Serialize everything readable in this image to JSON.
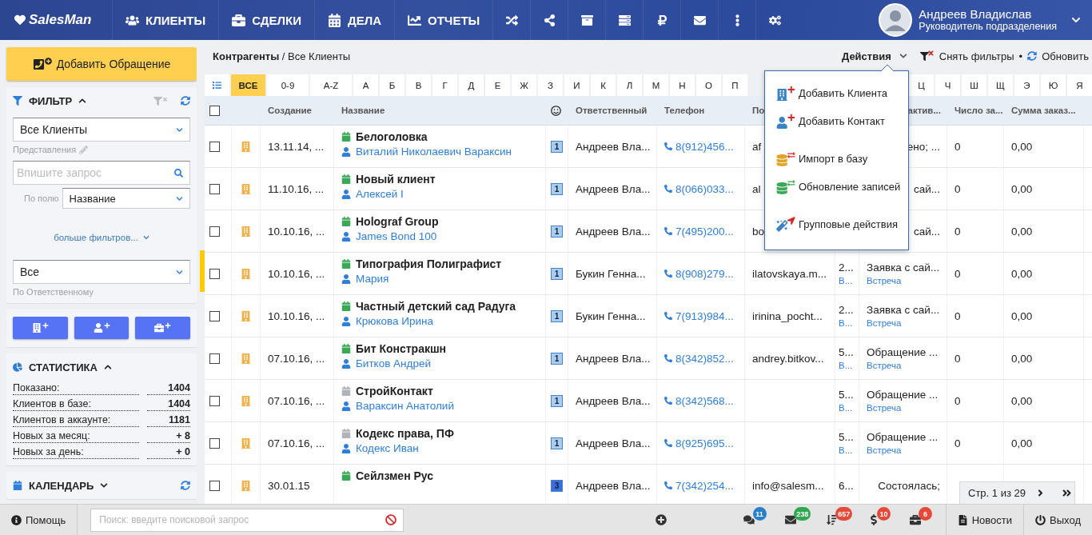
{
  "topbar": {
    "logo": "SalesMan",
    "nav": [
      {
        "label": "КЛИЕНТЫ"
      },
      {
        "label": "СДЕЛКИ"
      },
      {
        "label": "ДЕЛА"
      },
      {
        "label": "ОТЧЕТЫ"
      }
    ],
    "user": {
      "name": "Андреев Владислав",
      "role": "Руководитель подразделения"
    }
  },
  "sidebar": {
    "add_request_button": "Добавить Обращение",
    "filter": {
      "title": "ФИЛЬТР",
      "expanded": true,
      "view_select": "Все Клиенты",
      "view_label": "Представления",
      "search_placeholder": "Впишите запрос",
      "field_label": "По полю",
      "field_select": "Название",
      "more_filters": "больше фильтров...",
      "owner_select": "Все",
      "owner_label": "По Ответственному"
    },
    "statistics": {
      "title": "СТАТИСТИКА",
      "expanded": true,
      "rows": [
        {
          "label": "Показано:",
          "value": "1404"
        },
        {
          "label": "Клиентов в базе:",
          "value": "1404"
        },
        {
          "label": "Клиентов в аккаунте:",
          "value": "1181"
        },
        {
          "label": "Новых за месяц:",
          "value": "+ 8"
        },
        {
          "label": "Новых за день:",
          "value": "+ 0"
        }
      ]
    },
    "calendar": {
      "title": "КАЛЕНДАРЬ",
      "expanded": false
    }
  },
  "main": {
    "breadcrumb": "**Контрагенты** / Все Клиенты",
    "actions": {
      "label": "Действия",
      "expanded": true,
      "groups": [
        [
          {
            "label": "Добавить Клиента"
          },
          {
            "label": "Добавить Контакт"
          }
        ],
        [
          {
            "label": "Импорт в базу"
          },
          {
            "label": "Обновление записей"
          }
        ],
        [
          {
            "label": "Групповые действия"
          }
        ]
      ]
    },
    "clear_filters": "Снять фильтры",
    "separator": "•",
    "refresh": "Обновить",
    "letters_left": [
      {
        "label": "ВСЕ",
        "selected": true
      },
      {
        "label": "0-9",
        "selected": false
      },
      {
        "label": "A-Z",
        "selected": false
      },
      {
        "label": "А",
        "selected": false
      },
      {
        "label": "Б",
        "selected": false
      },
      {
        "label": "В",
        "selected": false
      },
      {
        "label": "Г",
        "selected": false
      },
      {
        "label": "Д",
        "selected": false
      },
      {
        "label": "Е",
        "selected": false
      },
      {
        "label": "Ж",
        "selected": false
      },
      {
        "label": "З",
        "selected": false
      },
      {
        "label": "И",
        "selected": false
      },
      {
        "label": "К",
        "selected": false
      },
      {
        "label": "Л",
        "selected": false
      },
      {
        "label": "М",
        "selected": false
      },
      {
        "label": "Н",
        "selected": false
      },
      {
        "label": "О",
        "selected": false
      },
      {
        "label": "П",
        "selected": false
      }
    ],
    "letters_right": [
      {
        "label": "Ц",
        "selected": false
      },
      {
        "label": "Ч",
        "selected": false
      },
      {
        "label": "Ш",
        "selected": false
      },
      {
        "label": "Щ",
        "selected": false
      },
      {
        "label": "Э",
        "selected": false
      },
      {
        "label": "Ю",
        "selected": false
      },
      {
        "label": "Я",
        "selected": false
      }
    ],
    "table": {
      "select_all_checked": false,
      "headers": {
        "created": "Создание",
        "name": "Название",
        "responsible": "Ответственный",
        "phone": "Телефон",
        "column_7": "По",
        "activity": "актив...",
        "orders_count": "Число за...",
        "orders_sum": "Сумма заказ..."
      },
      "rows": [
        {
          "checked": false,
          "created": "13.11.14, ...",
          "name": "Белоголовка",
          "calendar_active": true,
          "contact": "Виталий Николаевич Вараксин",
          "badge": {
            "text": "1",
            "color": "#a9cdf2"
          },
          "responsible": "Андреев Вла...",
          "phone": "8(912)456...",
          "column_7": "af",
          "activity": "ено; ...",
          "orders_count": "0",
          "orders_sum": "0,00"
        },
        {
          "checked": false,
          "created": "11.10.16, ...",
          "name": "Новый клиент",
          "calendar_active": true,
          "contact": "Алексей I",
          "badge": {
            "text": "1",
            "color": "#a9cdf2"
          },
          "responsible": "Андреев Вла...",
          "phone": "8(066)033...",
          "column_7": "al",
          "activity": "сай...",
          "orders_count": "0",
          "orders_sum": "0,00"
        },
        {
          "checked": false,
          "created": "10.10.16, ...",
          "name": "Holograf Group",
          "calendar_active": true,
          "contact": "James Bond 100",
          "badge": {
            "text": "1",
            "color": "#a9cdf2"
          },
          "responsible": "Андреев Вла...",
          "phone": "7(495)200...",
          "column_7": "bo",
          "activity": "сай...",
          "orders_count": "0",
          "orders_sum": "0,00"
        },
        {
          "checked": false,
          "created": "10.10.16, ...",
          "name": "Типография Полиграфист",
          "calendar_active": true,
          "contact": "Мария",
          "badge": {
            "text": "1",
            "color": "#a9cdf2"
          },
          "responsible": "Букин Генна...",
          "phone": "8(908)279...",
          "column_7": "ilatovskaya.m...",
          "column_8": "2...",
          "column_8_link": "В...",
          "activity": "Заявка с сай...",
          "activity_type": "Встреча",
          "orders_count": "0",
          "orders_sum": "0,00"
        },
        {
          "checked": false,
          "created": "10.10.16, ...",
          "name": "Частный детский сад Радуга",
          "calendar_active": true,
          "contact": "Крюкова Ирина",
          "badge": {
            "text": "1",
            "color": "#a9cdf2"
          },
          "responsible": "Букин Генна...",
          "phone": "7(913)984...",
          "column_7": "irinina_pocht...",
          "column_8": "2...",
          "column_8_link": "В...",
          "activity": "Заявка с сай...",
          "activity_type": "Встреча",
          "orders_count": "0",
          "orders_sum": "0,00"
        },
        {
          "checked": false,
          "created": "07.10.16, ...",
          "name": "Бит Констракшн",
          "calendar_active": true,
          "contact": "Битков Андрей",
          "badge": {
            "text": "1",
            "color": "#a9cdf2"
          },
          "responsible": "Андреев Вла...",
          "phone": "8(342)852...",
          "column_7": "andrey.bitkov...",
          "column_8": "5...",
          "column_8_link": "В...",
          "activity": "Обращение ...",
          "activity_type": "Встреча",
          "orders_count": "0",
          "orders_sum": "0,00"
        },
        {
          "checked": false,
          "created": "07.10.16, ...",
          "name": "СтройКонтакт",
          "calendar_active": false,
          "contact": "Вараксин Анатолий",
          "badge": {
            "text": "1",
            "color": "#a9cdf2"
          },
          "responsible": "Андреев Вла...",
          "phone": "8(342)568...",
          "column_8": "5...",
          "column_8_link": "В...",
          "activity": "Обращение ...",
          "activity_type": "Встреча",
          "orders_count": "0",
          "orders_sum": "0,00"
        },
        {
          "checked": false,
          "created": "07.10.16, ...",
          "name": "Кодекс права, ПФ",
          "calendar_active": false,
          "contact": "Кодекс Иван",
          "badge": {
            "text": "1",
            "color": "#a9cdf2"
          },
          "responsible": "Андреев Вла...",
          "phone": "8(925)695...",
          "column_8": "5...",
          "column_8_link": "В...",
          "activity": "Обращение ...",
          "activity_type": "Встреча",
          "orders_count": "0",
          "orders_sum": "0,00"
        },
        {
          "checked": false,
          "created": "30.01.15",
          "name": "Сейлзмен Рус",
          "calendar_active": true,
          "badge": {
            "text": "3",
            "color": "#3d6ee0"
          },
          "responsible": "Андреев Вла...",
          "phone": "7(342)254...",
          "column_7": "info@salesm...",
          "column_8": "6...",
          "activity": "Состоялась;"
        }
      ]
    },
    "pagination": {
      "label": "Стр. 1 из 29"
    }
  },
  "bottombar": {
    "help": "Помощь",
    "search_placeholder": "Поиск: введите поисковой запрос",
    "counters": [
      {
        "count": "11",
        "color": "#2a7fc9"
      },
      {
        "count": "238",
        "color": "#2fa84f"
      },
      {
        "count": "657",
        "color": "#e5493a"
      },
      {
        "count": "10",
        "color": "#e5493a"
      },
      {
        "count": "6",
        "color": "#e5493a"
      }
    ],
    "news": "Новости",
    "logout": "Выход"
  }
}
